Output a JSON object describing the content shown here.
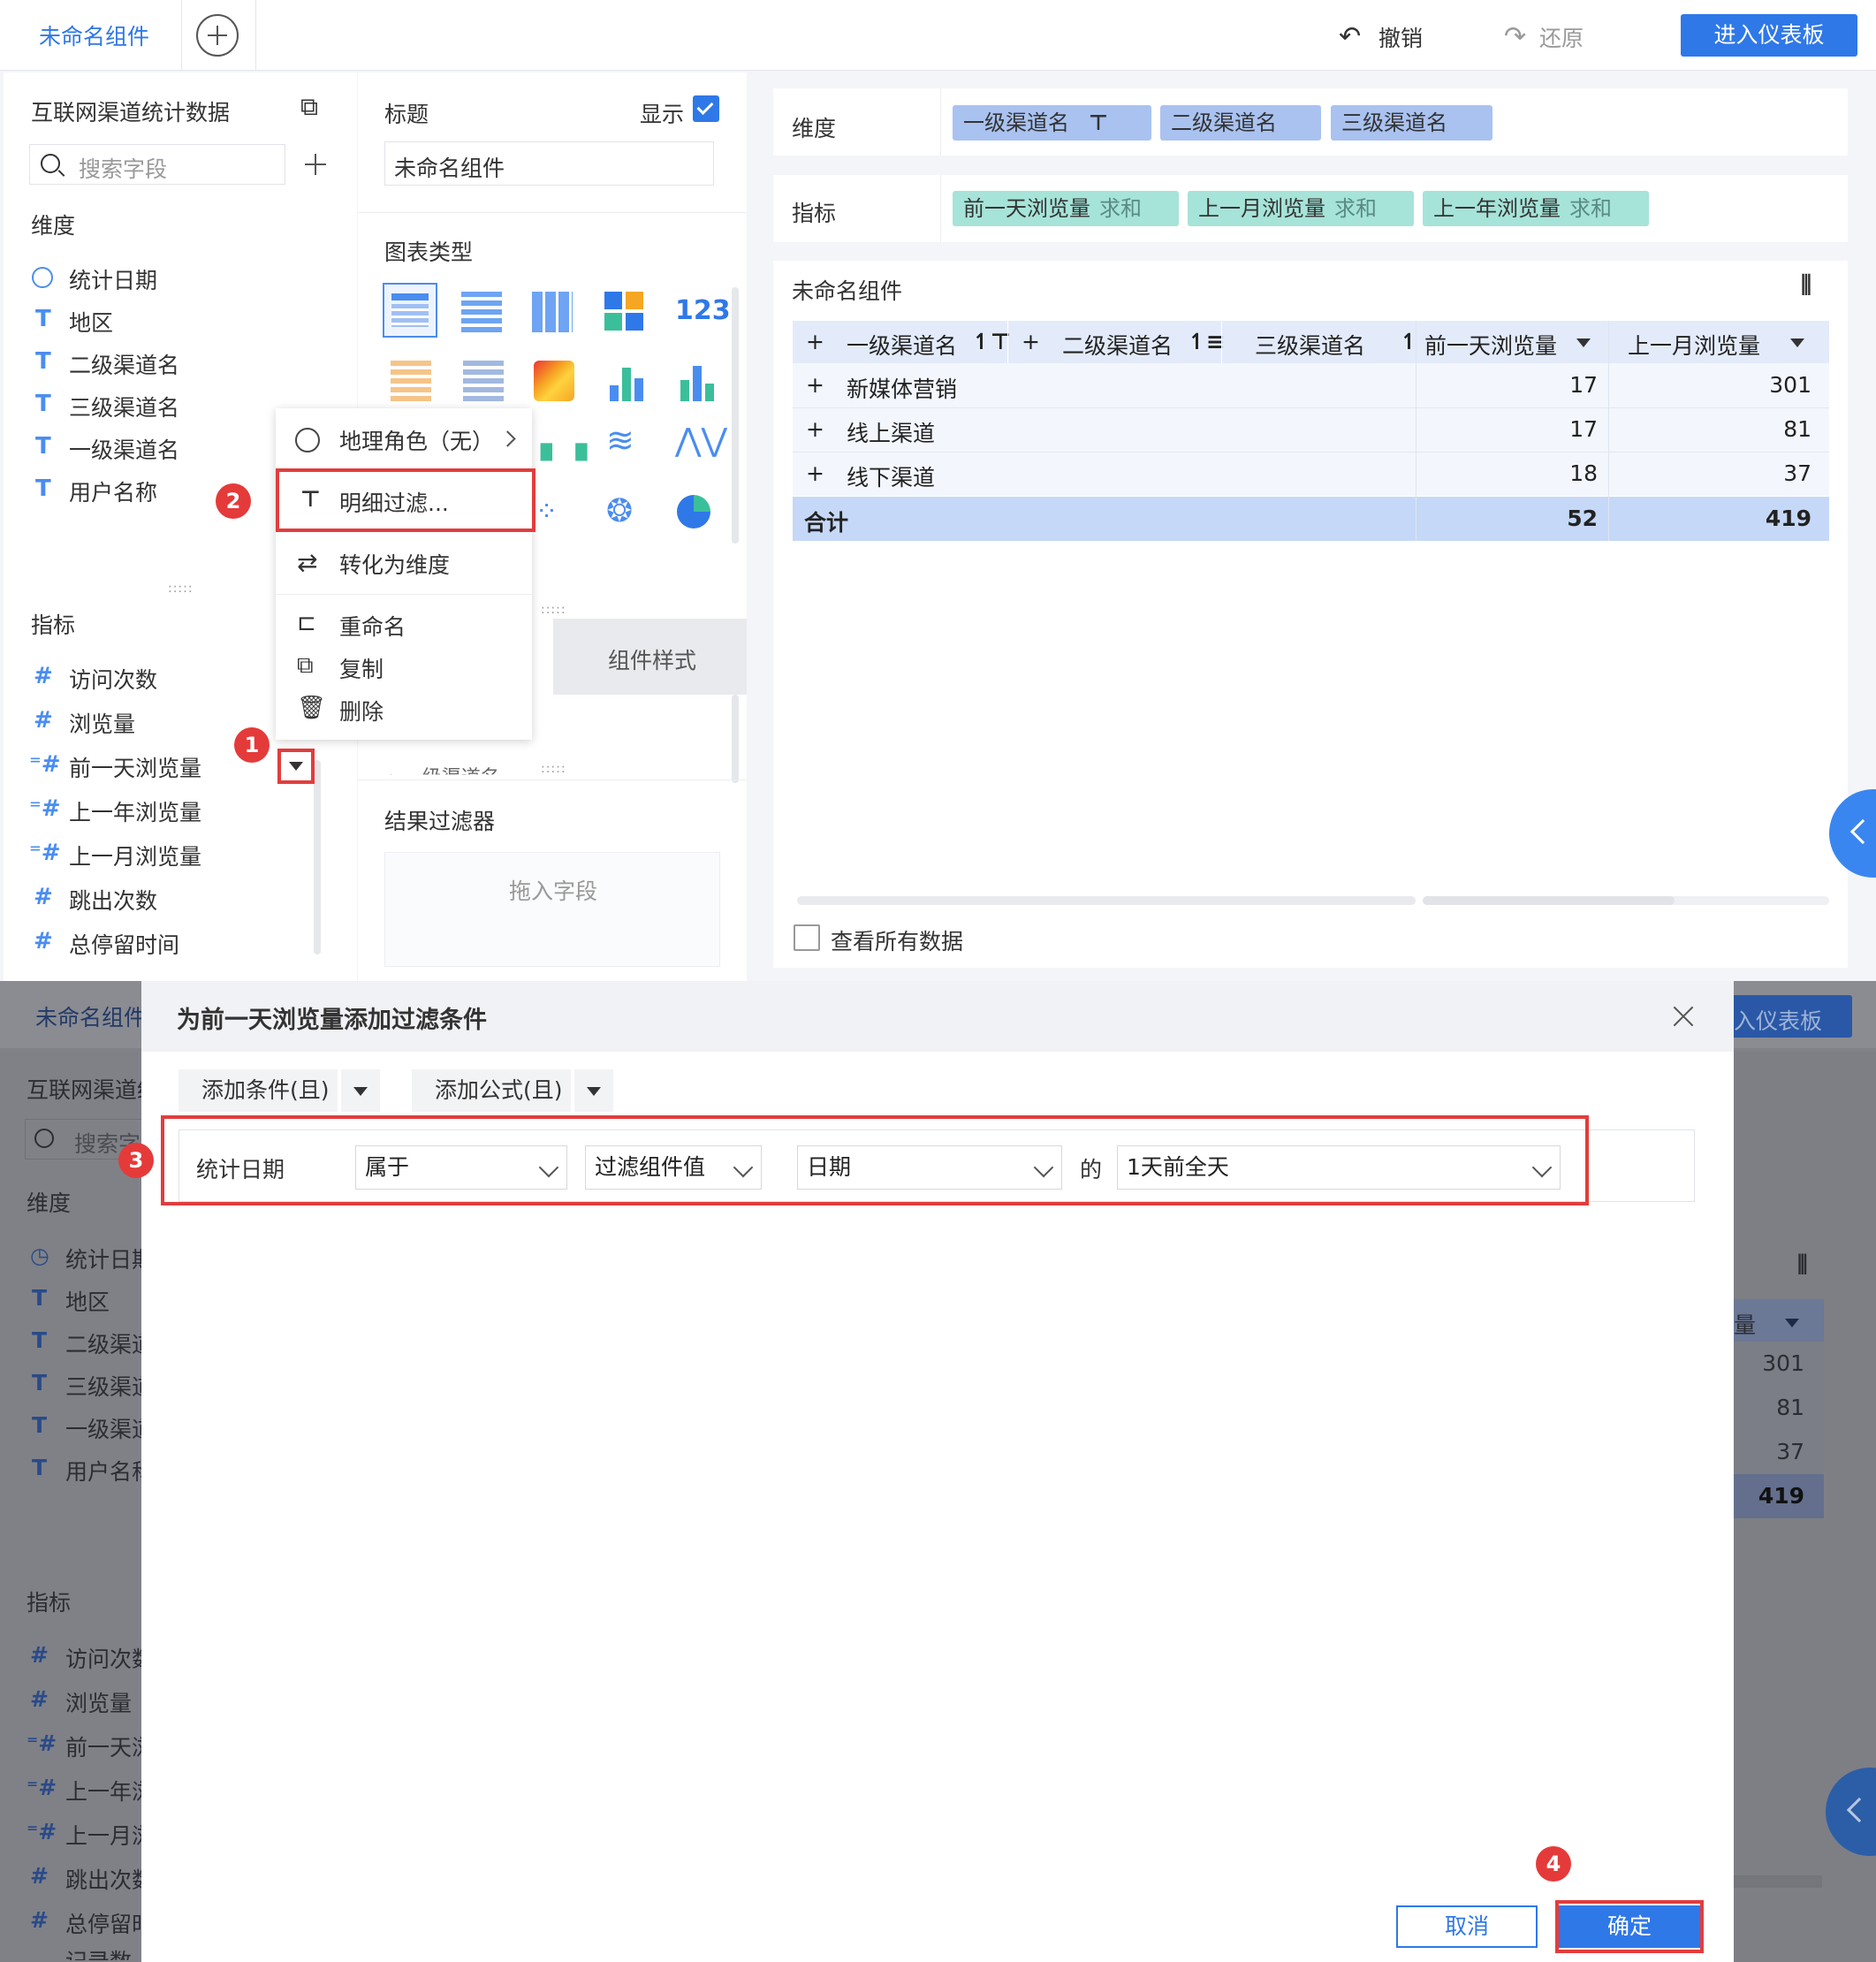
{
  "topbar": {
    "tab_title": "未命名组件",
    "undo": "撤销",
    "redo": "还原",
    "enter_dashboard": "进入仪表板"
  },
  "datasource": {
    "name": "互联网渠道统计数据",
    "search_placeholder": "搜索字段"
  },
  "dimensions": {
    "label": "维度",
    "items": [
      "统计日期",
      "地区",
      "二级渠道名",
      "三级渠道名",
      "一级渠道名",
      "用户名称"
    ]
  },
  "metrics": {
    "label": "指标",
    "items": [
      "访问次数",
      "浏览量",
      "前一天浏览量",
      "上一年浏览量",
      "上一月浏览量",
      "跳出次数",
      "总停留时间",
      "记录数"
    ]
  },
  "context_menu": {
    "geo_role": "地理角色（无）",
    "detail_filter": "明细过滤...",
    "to_dimension": "转化为维度",
    "rename": "重命名",
    "copy": "复制",
    "delete": "删除"
  },
  "config": {
    "title_label": "标题",
    "show_label": "显示",
    "title_value": "未命名组件",
    "chart_type_label": "图表类型",
    "component_style": "组件样式",
    "result_filter": "结果过滤器",
    "drop_hint": "拖入字段",
    "partial_field": "一级渠道名"
  },
  "shelf": {
    "dim_label": "维度",
    "dims": [
      "一级渠道名",
      "二级渠道名",
      "三级渠道名"
    ],
    "met_label": "指标",
    "mets": [
      {
        "name": "前一天浏览量",
        "agg": "求和"
      },
      {
        "name": "上一月浏览量",
        "agg": "求和"
      },
      {
        "name": "上一年浏览量",
        "agg": "求和"
      }
    ]
  },
  "preview": {
    "title": "未命名组件",
    "headers": [
      "一级渠道名",
      "二级渠道名",
      "三级渠道名",
      "前一天浏览量",
      "上一月浏览量"
    ],
    "rows": [
      {
        "name": "新媒体营销",
        "v1": "17",
        "v2": "301"
      },
      {
        "name": "线上渠道",
        "v1": "17",
        "v2": "81"
      },
      {
        "name": "线下渠道",
        "v1": "18",
        "v2": "37"
      }
    ],
    "total": {
      "name": "合计",
      "v1": "52",
      "v2": "419"
    },
    "view_all": "查看所有数据"
  },
  "dialog": {
    "title": "为前一天浏览量添加过滤条件",
    "add_condition": "添加条件(且)",
    "add_formula": "添加公式(且)",
    "cond_field": "统计日期",
    "cond_op": "属于",
    "cond_type": "过滤组件值",
    "cond_unit": "日期",
    "cond_of": "的",
    "cond_value": "1天前全天",
    "cancel": "取消",
    "ok": "确定"
  },
  "bg2": {
    "tab_title": "未命名组件",
    "enter_dashboard_partial": "入仪表板",
    "source_partial": "互联网渠道统",
    "search_partial": "搜索字",
    "dims_partial": [
      "统计日期",
      "地区",
      "二级渠道",
      "三级渠道",
      "一级渠道",
      "用户名称"
    ],
    "mets_partial": [
      "访问次数",
      "浏览量",
      "前一天浏",
      "上一年浏",
      "上一月浏",
      "跳出次数",
      "总停留时",
      "记录数"
    ],
    "vals": [
      "301",
      "81",
      "37",
      "419"
    ],
    "col_partial": "量"
  },
  "badges": [
    "1",
    "2",
    "3",
    "4"
  ],
  "colors": {
    "accent": "#2f78e8",
    "highlight": "#e23d3d",
    "dim_pill": "#a9c2f0",
    "met_pill": "#a6e3d8"
  }
}
